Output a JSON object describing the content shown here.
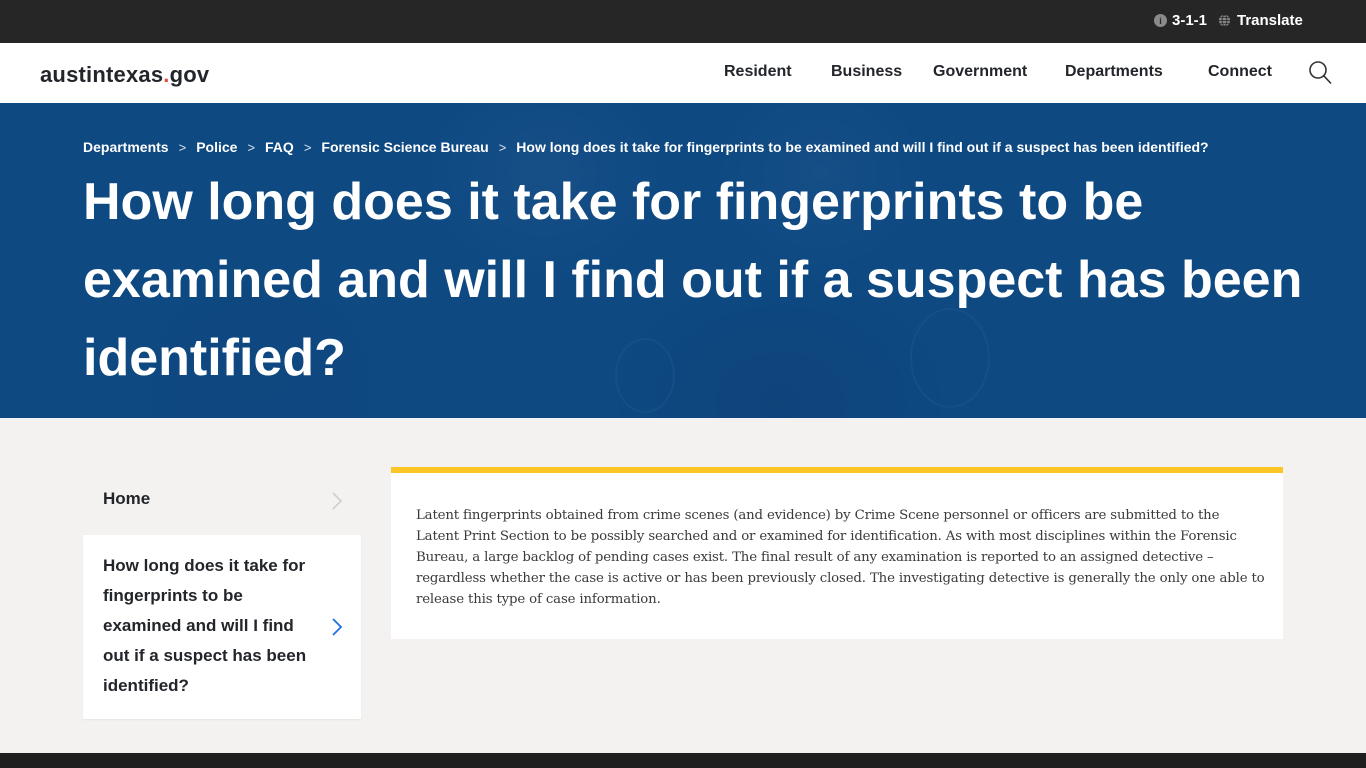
{
  "utility_bar": {
    "phone_label": "3-1-1",
    "phone_icon": "info-icon",
    "translate_label": "Translate",
    "translate_icon": "globe-icon"
  },
  "header": {
    "logo_main": "austintexas",
    "logo_dot": ".",
    "logo_tld": "gov",
    "nav": [
      {
        "label": "Resident"
      },
      {
        "label": "Business"
      },
      {
        "label": "Government"
      },
      {
        "label": "Departments"
      },
      {
        "label": "Connect"
      }
    ],
    "search_icon": "search-icon"
  },
  "hero": {
    "breadcrumb": [
      {
        "label": "Departments"
      },
      {
        "label": "Police"
      },
      {
        "label": "FAQ"
      },
      {
        "label": "Forensic Science Bureau"
      }
    ],
    "breadcrumb_separator": ">",
    "breadcrumb_current": "How long does it take for fingerprints to be examined and will I find out if a suspect has been identified?",
    "title": "How long does it take for fingerprints to be examined and will I find out if a suspect has been identified?"
  },
  "side_nav": {
    "home_label": "Home",
    "current_label": "How long does it take for fingerprints to be examined and will I find out if a suspect has been identified?"
  },
  "content": {
    "body": "Latent fingerprints obtained from crime scenes (and evidence) by Crime Scene personnel or officers are submitted to the Latent Print Section to be possibly searched and or examined for identification. As with most disciplines within the Forensic Bureau, a large backlog of pending cases exist. The final result of any examination is reported to an assigned detective – regardless whether the case is active or has been previously closed. The investigating detective is generally the only one able to release this type of case information."
  },
  "colors": {
    "utility_bg": "#262626",
    "hero_blue": "#0f4a84",
    "accent_yellow": "#fcc526",
    "logo_dot": "#e0533d",
    "chevron_active": "#1f6fe0",
    "page_bg": "#f3f2f0"
  }
}
